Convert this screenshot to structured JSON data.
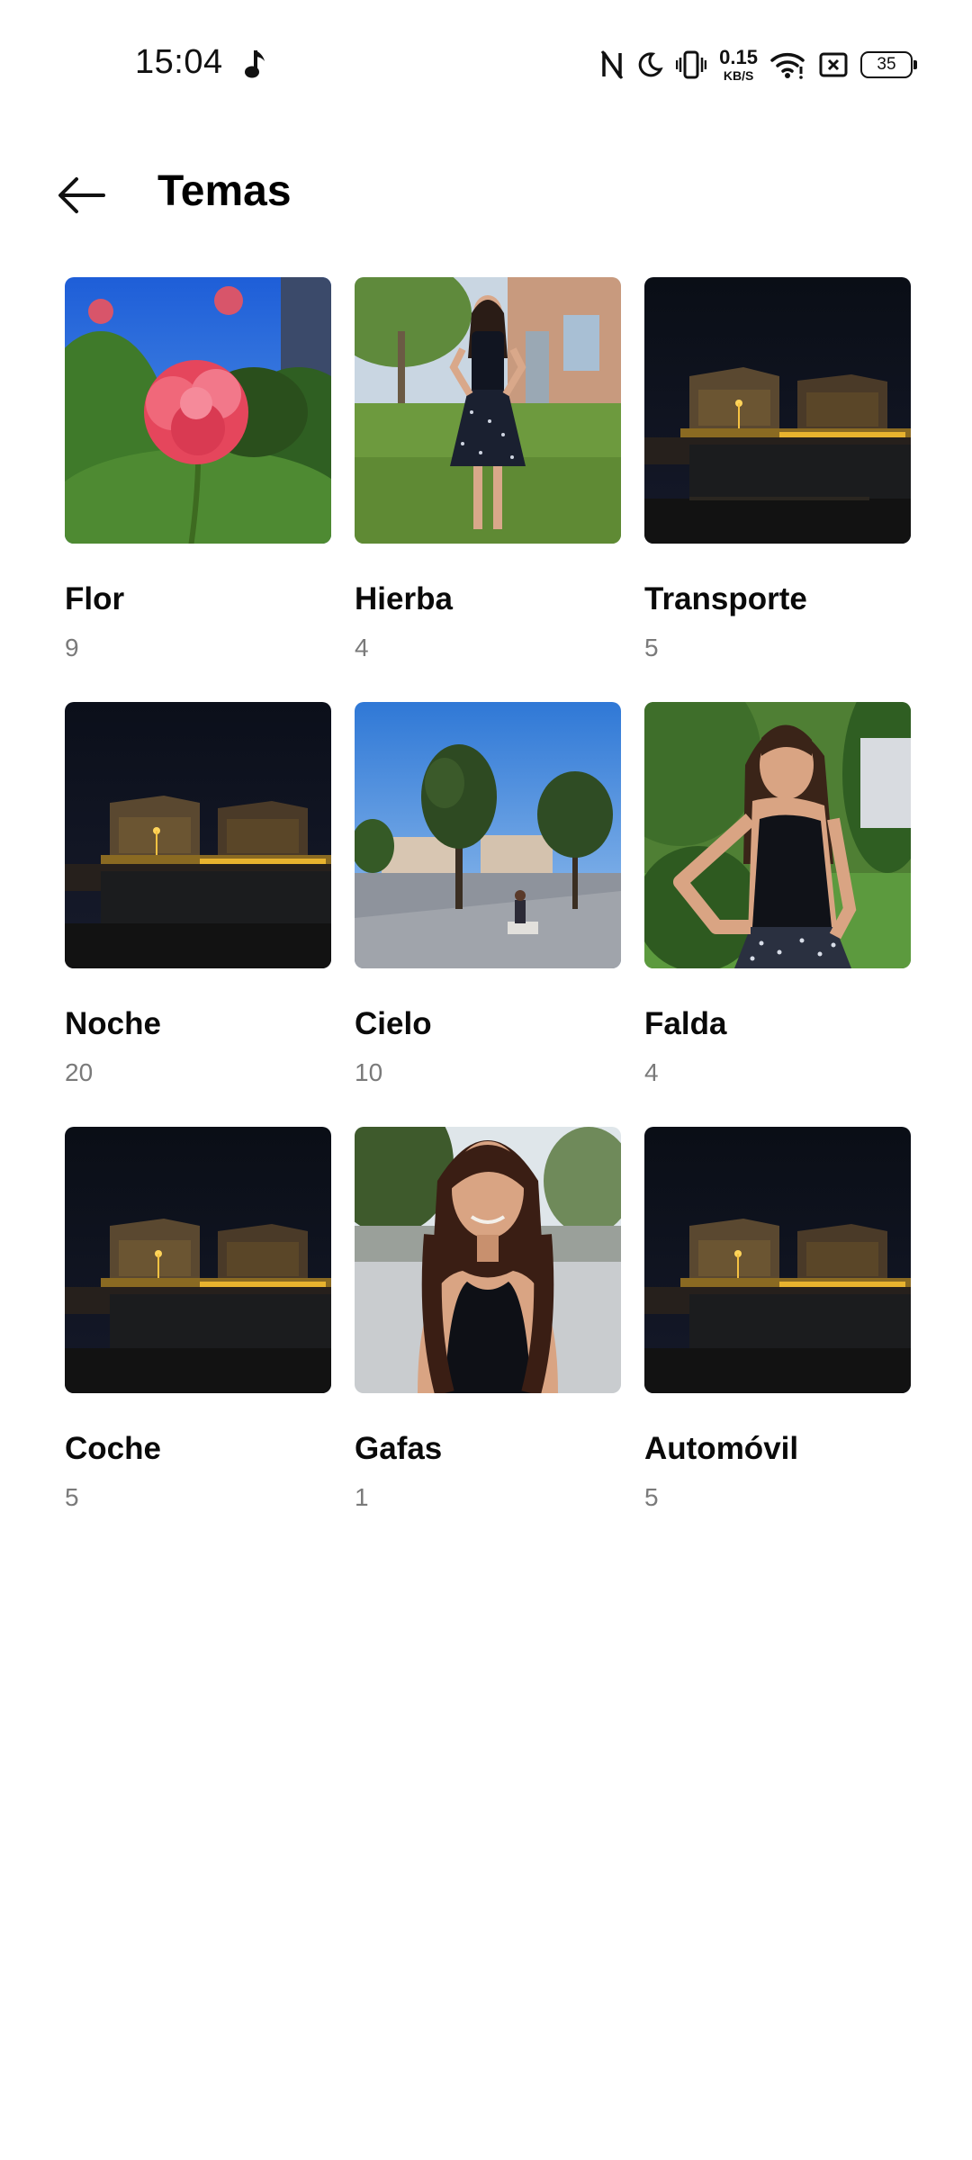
{
  "status_bar": {
    "time": "15:04",
    "net_speed_value": "0.15",
    "net_speed_unit": "KB/S",
    "battery_level": "35",
    "icons": [
      "music-note-icon",
      "nfc-icon",
      "moon-icon",
      "vibrate-icon",
      "wifi-icon",
      "sim-blocked-icon",
      "battery-icon"
    ]
  },
  "header": {
    "back_icon": "back-arrow-icon",
    "title": "Temas"
  },
  "topics": [
    {
      "name": "Flor",
      "count": "9",
      "thumb": "rose"
    },
    {
      "name": "Hierba",
      "count": "4",
      "thumb": "woman-grass"
    },
    {
      "name": "Transporte",
      "count": "5",
      "thumb": "night-street"
    },
    {
      "name": "Noche",
      "count": "20",
      "thumb": "night-street"
    },
    {
      "name": "Cielo",
      "count": "10",
      "thumb": "sky-trees"
    },
    {
      "name": "Falda",
      "count": "4",
      "thumb": "woman-closeup"
    },
    {
      "name": "Coche",
      "count": "5",
      "thumb": "night-street"
    },
    {
      "name": "Gafas",
      "count": "1",
      "thumb": "woman-portrait"
    },
    {
      "name": "Automóvil",
      "count": "5",
      "thumb": "night-street"
    }
  ]
}
